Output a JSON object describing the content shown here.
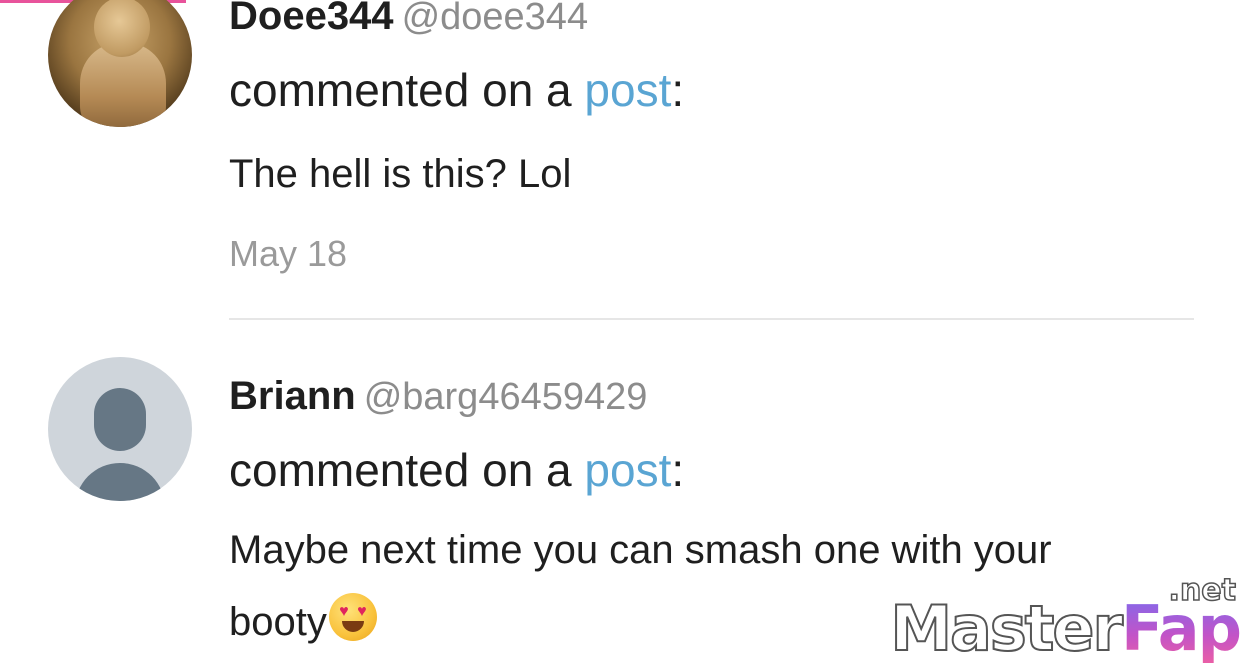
{
  "comments": [
    {
      "display_name": "Doee344",
      "handle": "@doee344",
      "action_prefix": "commented on a ",
      "action_link": "post",
      "action_suffix": ":",
      "body": "The hell is this? Lol",
      "timestamp": "May 18"
    },
    {
      "display_name": "Briann",
      "handle": "@barg46459429",
      "action_prefix": "commented on a ",
      "action_link": "post",
      "action_suffix": ":",
      "body": "Maybe next time you can smash one with your booty",
      "body_emoji": "smiling-face-with-heart-eyes"
    }
  ],
  "watermark": {
    "part1": "Master",
    "part2": "Fap",
    "tld": ".net"
  },
  "colors": {
    "link": "#5aa5d3",
    "text": "#1f1f1f",
    "muted": "#8c8c8c",
    "accent": "#e8539b"
  }
}
